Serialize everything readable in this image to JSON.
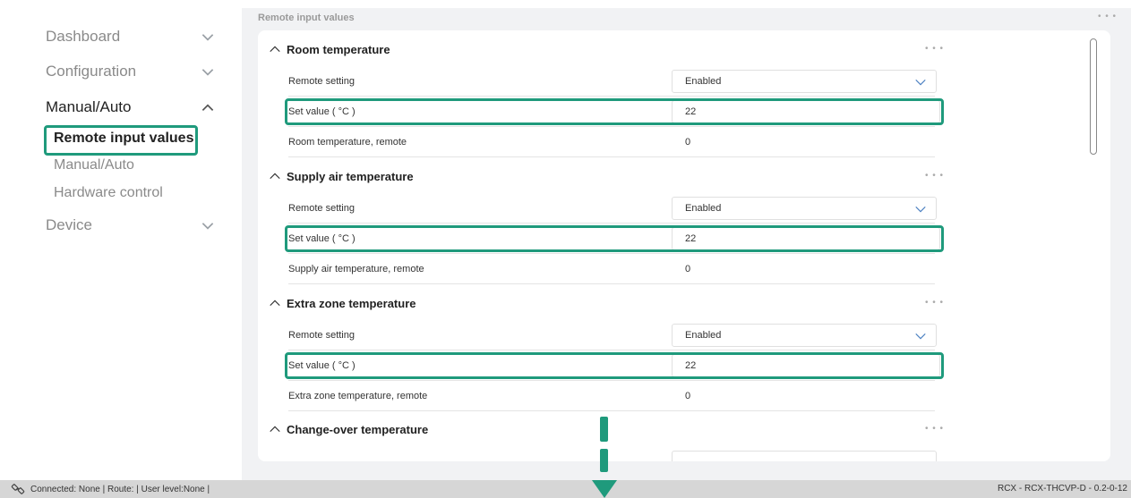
{
  "sidebar": {
    "items": [
      {
        "label": "Dashboard"
      },
      {
        "label": "Configuration"
      },
      {
        "label": "Manual/Auto"
      },
      {
        "label": "Device"
      }
    ],
    "subitems": [
      {
        "label": "Remote input values"
      },
      {
        "label": "Manual/Auto"
      },
      {
        "label": "Hardware control"
      }
    ]
  },
  "main": {
    "title": "Remote input values",
    "sections": [
      {
        "title": "Room temperature",
        "remote_setting_label": "Remote setting",
        "remote_setting_value": "Enabled",
        "set_value_label": "Set value ( °C )",
        "set_value": "22",
        "remote_label": "Room temperature, remote",
        "remote_value": "0"
      },
      {
        "title": "Supply air temperature",
        "remote_setting_label": "Remote setting",
        "remote_setting_value": "Enabled",
        "set_value_label": "Set value ( °C )",
        "set_value": "22",
        "remote_label": "Supply air temperature, remote",
        "remote_value": "0"
      },
      {
        "title": "Extra zone temperature",
        "remote_setting_label": "Remote setting",
        "remote_setting_value": "Enabled",
        "set_value_label": "Set value ( °C )",
        "set_value": "22",
        "remote_label": "Extra zone temperature, remote",
        "remote_value": "0"
      },
      {
        "title": "Change-over temperature"
      }
    ]
  },
  "statusbar": {
    "left": "Connected: None | Route: | User level:None |",
    "right": "RCX - RCX-THCVP-D - 0.2-0-12"
  },
  "colors": {
    "accent": "#1f9a7c",
    "background": "#f1f2f4",
    "statusbar": "#d6d6d6"
  },
  "icons": [
    "chevron-down-icon",
    "chevron-up-icon",
    "more-icon",
    "connection-icon",
    "arrow-down-icon"
  ]
}
